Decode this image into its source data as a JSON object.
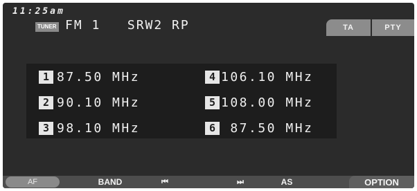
{
  "status": {
    "clock": "11:25am"
  },
  "source": {
    "badge": "TUNER",
    "line": "FM 1   SRW2 RP"
  },
  "top_buttons": {
    "ta": "TA",
    "pty": "PTY"
  },
  "presets": [
    {
      "num": "1",
      "freq": "87.50 MHz"
    },
    {
      "num": "2",
      "freq": "90.10 MHz"
    },
    {
      "num": "3",
      "freq": "98.10 MHz"
    },
    {
      "num": "4",
      "freq": "106.10 MHz"
    },
    {
      "num": "5",
      "freq": "108.00 MHz"
    },
    {
      "num": "6",
      "freq": " 87.50 MHz"
    }
  ],
  "bottom_bar": {
    "af": "AF",
    "band": "BAND",
    "prev": "⏮",
    "next": "⏭",
    "as": "AS",
    "option": "OPTION"
  },
  "colors": {
    "screen_bg": "#2b2b2b",
    "preset_panel_bg": "#1d1d1d",
    "button_gray": "#8c8c8c",
    "text": "#f0f0f0"
  }
}
